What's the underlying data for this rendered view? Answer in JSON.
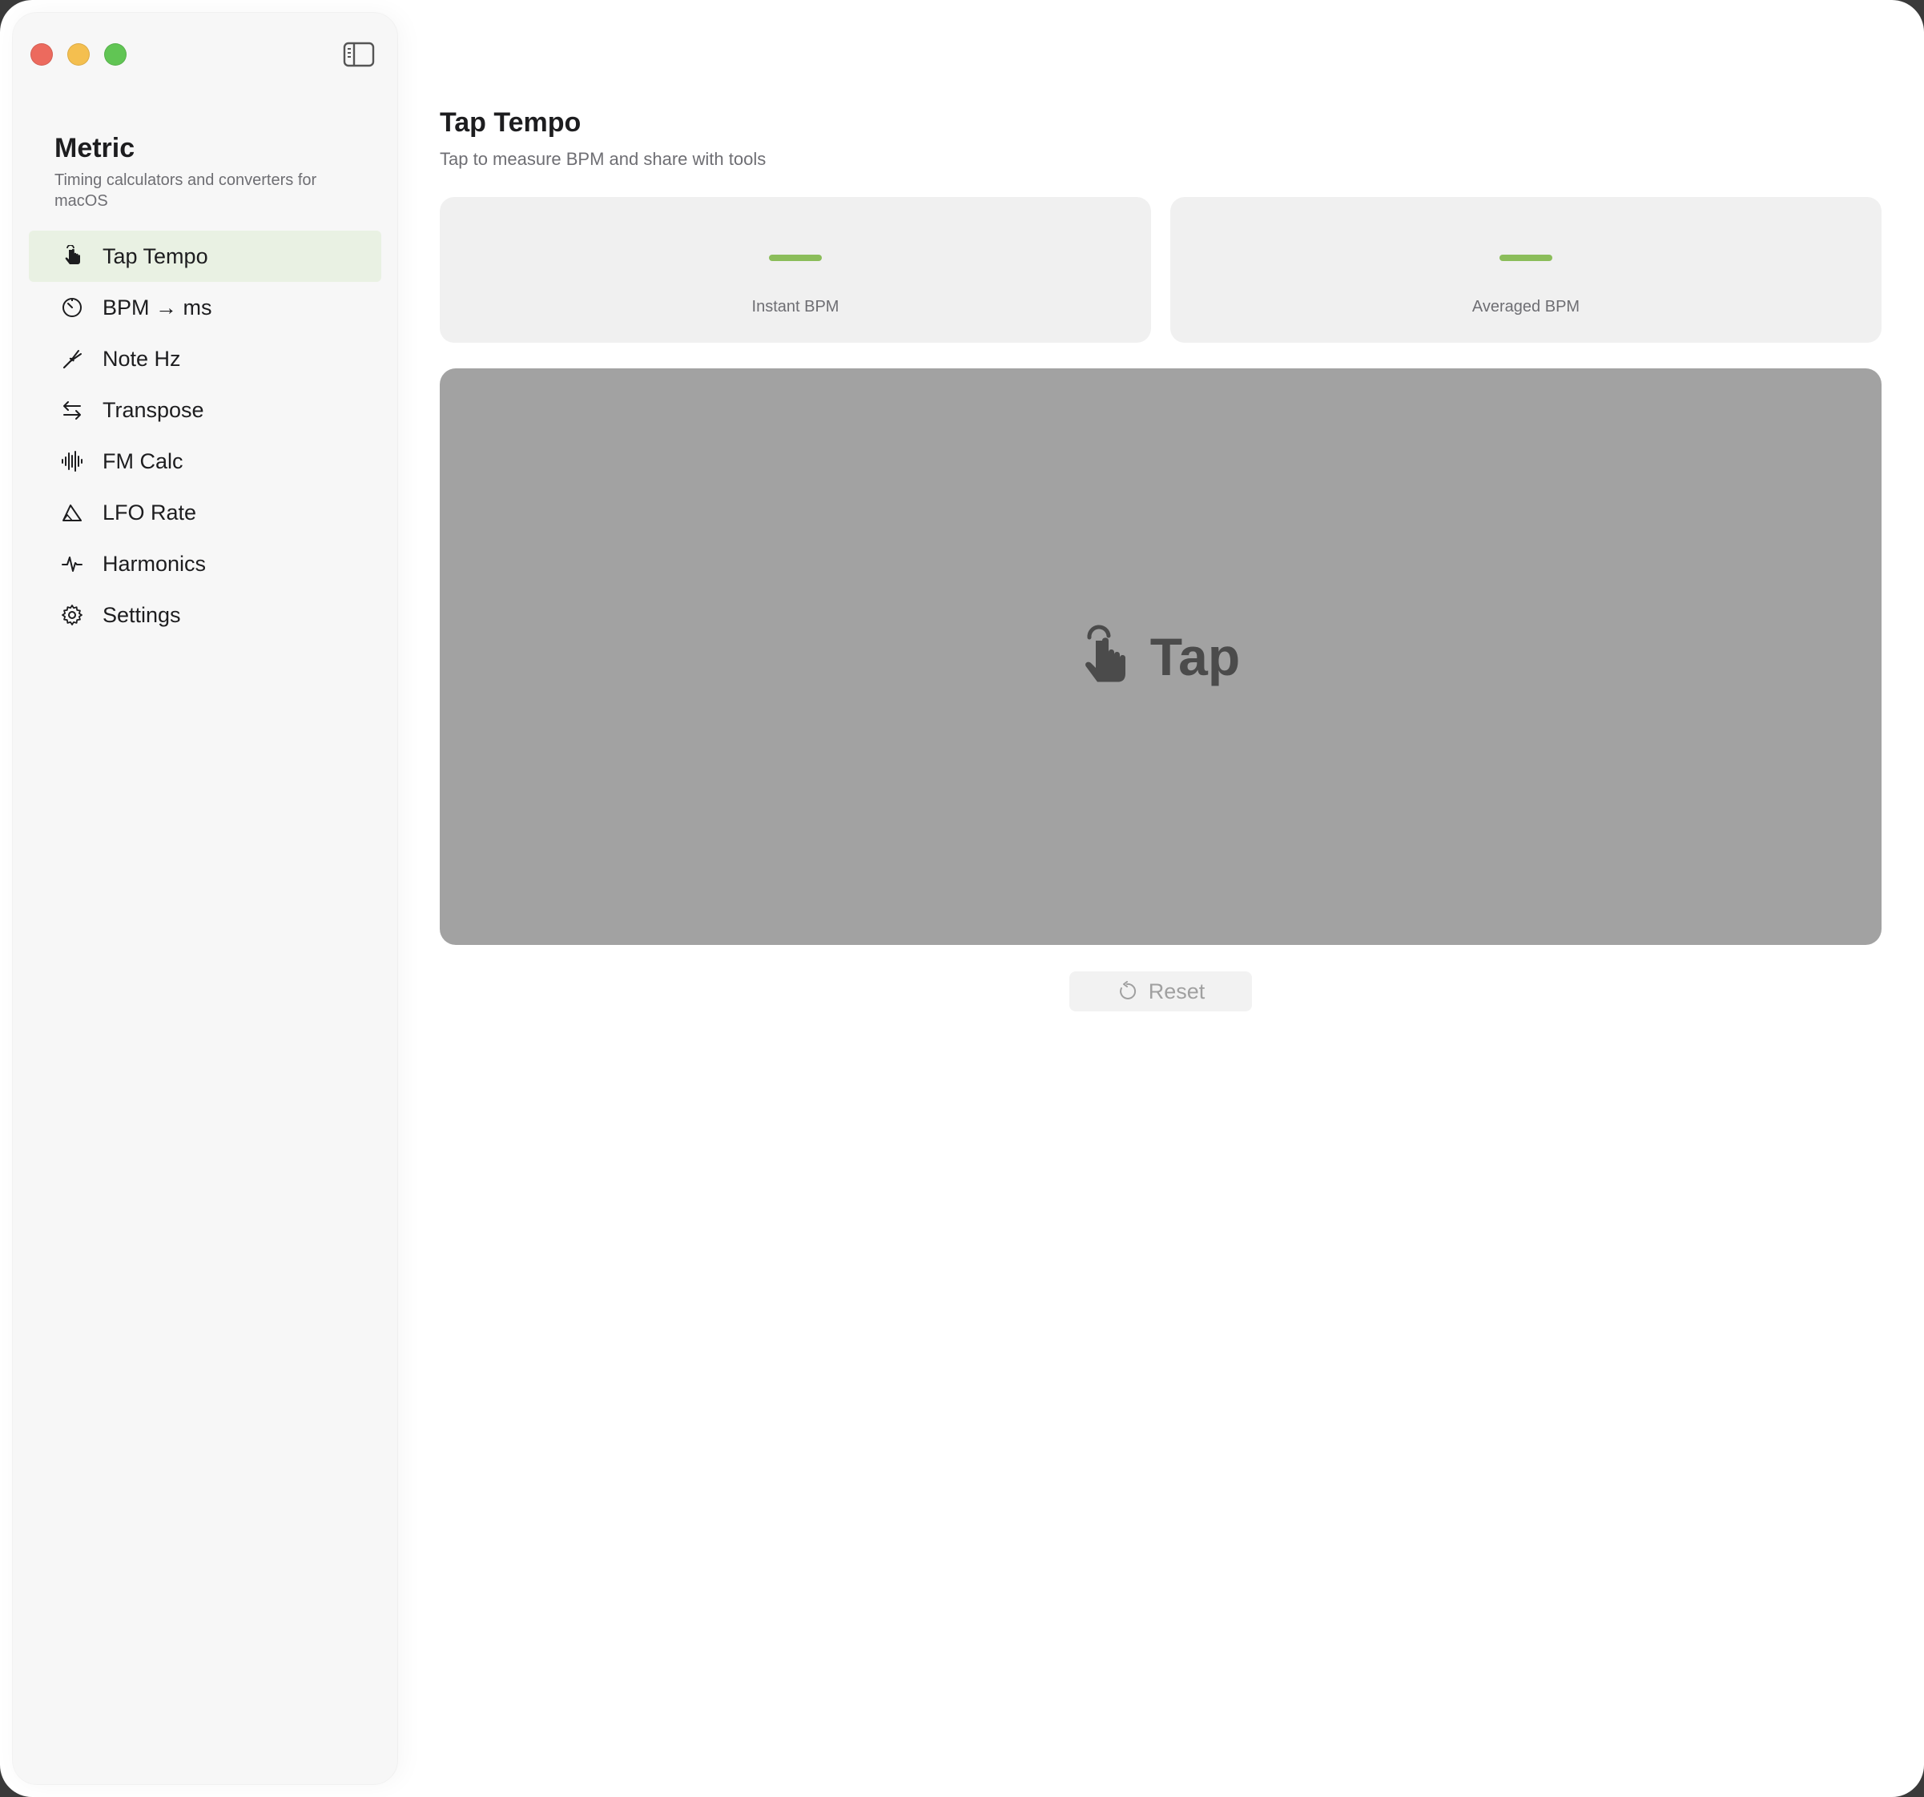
{
  "window": {
    "controls": [
      "close",
      "minimize",
      "zoom"
    ],
    "colors": {
      "close": "#ec6a5e",
      "minimize": "#f4bf4f",
      "zoom": "#61c554"
    }
  },
  "sidebar": {
    "app_title": "Metric",
    "app_subtitle": "Timing calculators and converters for macOS",
    "toggle_icon": "sidebar-toggle-icon",
    "active_color": "#e9f1e3",
    "items": [
      {
        "label": "Tap Tempo",
        "icon": "hand-tap-icon",
        "active": true
      },
      {
        "label": "BPM → ms",
        "icon": "timer-icon",
        "active": false
      },
      {
        "label": "Note Hz",
        "icon": "tuning-fork-icon",
        "active": false
      },
      {
        "label": "Transpose",
        "icon": "arrows-swap-icon",
        "active": false
      },
      {
        "label": "FM Calc",
        "icon": "waveform-icon",
        "active": false
      },
      {
        "label": "LFO Rate",
        "icon": "triangle-wave-icon",
        "active": false
      },
      {
        "label": "Harmonics",
        "icon": "pulse-icon",
        "active": false
      },
      {
        "label": "Settings",
        "icon": "gear-icon",
        "active": false
      }
    ]
  },
  "main": {
    "title": "Tap Tempo",
    "subtitle": "Tap to measure BPM and share with tools",
    "stats": [
      {
        "label": "Instant BPM",
        "value": "—"
      },
      {
        "label": "Averaged BPM",
        "value": "—"
      }
    ],
    "accent_color": "#8bbd5a",
    "tap_pad": {
      "label": "Tap",
      "icon": "hand-tap-icon"
    },
    "reset": {
      "label": "Reset",
      "icon": "reset-icon"
    }
  }
}
